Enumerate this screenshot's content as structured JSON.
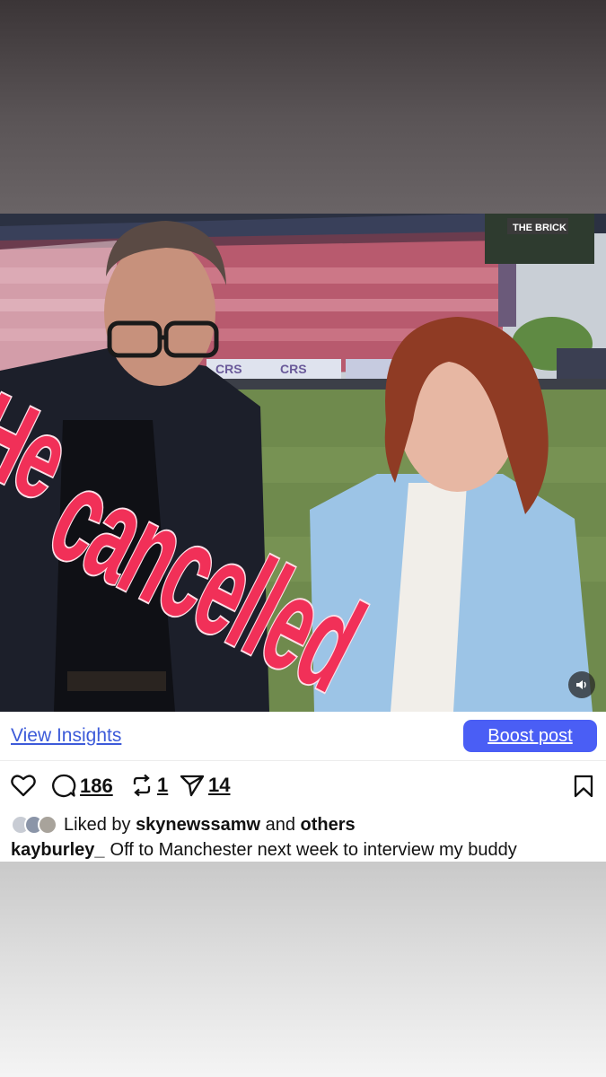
{
  "overlay": {
    "line1": "He",
    "line2": "cancelled"
  },
  "stadium_sign": "THE BRICK",
  "banner_text": "CRS",
  "insights": {
    "view_insights_label": "View Insights",
    "boost_label": "Boost post"
  },
  "actions": {
    "comments_count": "186",
    "reposts_count": "1",
    "shares_count": "14"
  },
  "likes": {
    "prefix": "Liked by",
    "user": "skynewssamw",
    "connector": "and",
    "suffix": "others"
  },
  "caption": {
    "username": "kayburley_",
    "text": "Off to Manchester next week to interview my buddy"
  },
  "colors": {
    "overlay_text": "#f13058",
    "link_blue": "#3d5bd9",
    "boost_bg": "#4a5ef5"
  }
}
